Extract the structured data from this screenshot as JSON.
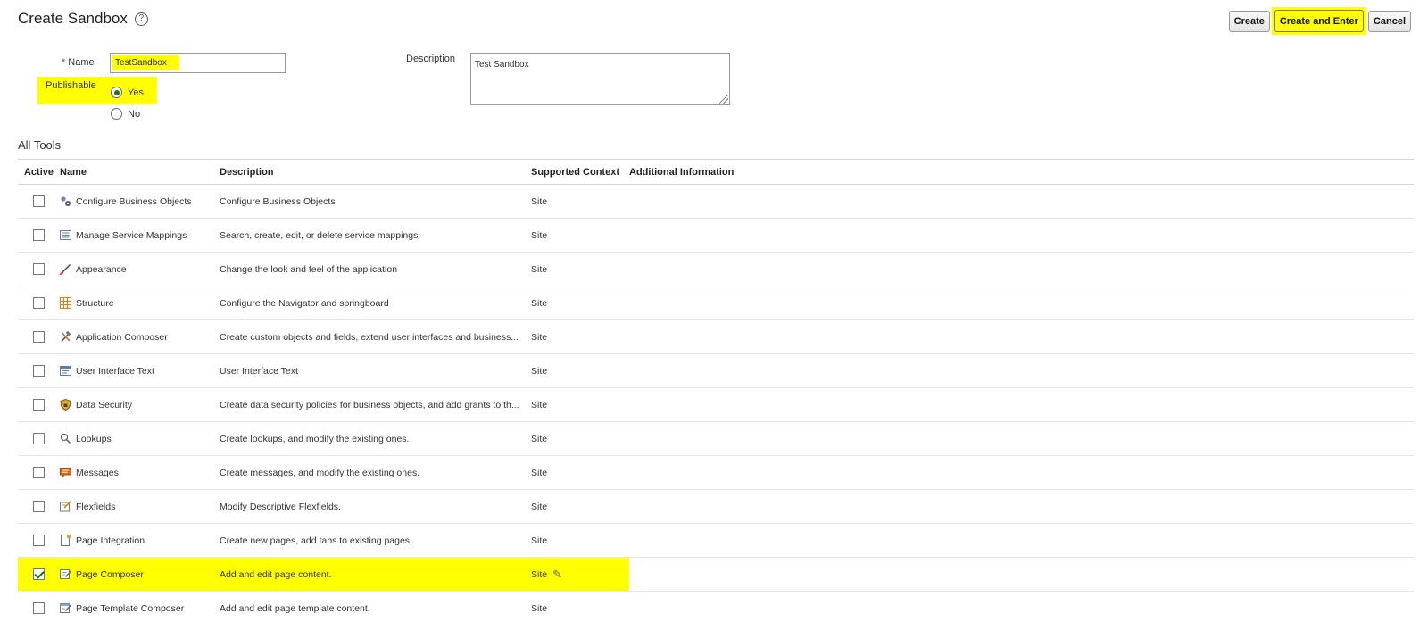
{
  "header": {
    "title": "Create Sandbox",
    "help_icon": "help-circle-icon",
    "buttons": {
      "create": "Create",
      "create_and_enter": "Create and Enter",
      "cancel": "Cancel"
    }
  },
  "form": {
    "name_label": "Name",
    "name_required_marker": "*",
    "name_value": "TestSandbox",
    "publishable_label": "Publishable",
    "publishable_options": [
      "Yes",
      "No"
    ],
    "publishable_selected": "Yes",
    "description_label": "Description",
    "description_value": "Test Sandbox"
  },
  "tools": {
    "section_title": "All Tools",
    "columns": [
      "Active",
      "Name",
      "Description",
      "Supported Context",
      "Additional Information"
    ],
    "rows": [
      {
        "active": false,
        "icon": "business-objects-gear-icon",
        "name": "Configure Business Objects",
        "description": "Configure Business Objects",
        "context": "Site"
      },
      {
        "active": false,
        "icon": "service-mappings-list-icon",
        "name": "Manage Service Mappings",
        "description": "Search, create, edit, or delete service mappings",
        "context": "Site"
      },
      {
        "active": false,
        "icon": "paintbrush-icon",
        "name": "Appearance",
        "description": "Change the look and feel of the application",
        "context": "Site"
      },
      {
        "active": false,
        "icon": "structure-grid-icon",
        "name": "Structure",
        "description": "Configure the Navigator and springboard",
        "context": "Site"
      },
      {
        "active": false,
        "icon": "tools-hammer-wrench-icon",
        "name": "Application Composer",
        "description": "Create custom objects and fields, extend user interfaces and business...",
        "context": "Site"
      },
      {
        "active": false,
        "icon": "ui-text-window-icon",
        "name": "User Interface Text",
        "description": "User Interface Text",
        "context": "Site"
      },
      {
        "active": false,
        "icon": "security-shield-icon",
        "name": "Data Security",
        "description": "Create data security policies for business objects, and add grants to th...",
        "context": "Site"
      },
      {
        "active": false,
        "icon": "magnifier-icon",
        "name": "Lookups",
        "description": "Create lookups, and modify the existing ones.",
        "context": "Site"
      },
      {
        "active": false,
        "icon": "message-bubble-icon",
        "name": "Messages",
        "description": "Create messages, and modify the existing ones.",
        "context": "Site"
      },
      {
        "active": false,
        "icon": "flexfields-edit-icon",
        "name": "Flexfields",
        "description": "Modify Descriptive Flexfields.",
        "context": "Site"
      },
      {
        "active": false,
        "icon": "page-integration-icon",
        "name": "Page Integration",
        "description": "Create new pages, add tabs to existing pages.",
        "context": "Site"
      },
      {
        "active": true,
        "icon": "page-composer-icon",
        "name": "Page Composer",
        "description": "Add and edit page content.",
        "context": "Site",
        "highlighted": true,
        "context_icon": "pencil-icon"
      },
      {
        "active": false,
        "icon": "page-template-composer-icon",
        "name": "Page Template Composer",
        "description": "Add and edit page template content.",
        "context": "Site"
      }
    ]
  },
  "colors": {
    "highlight": "#ffff00",
    "radio_selected": "#2f6f1f",
    "checkbox_check": "#1d6e1d",
    "required_star": "#1a5fb4"
  }
}
